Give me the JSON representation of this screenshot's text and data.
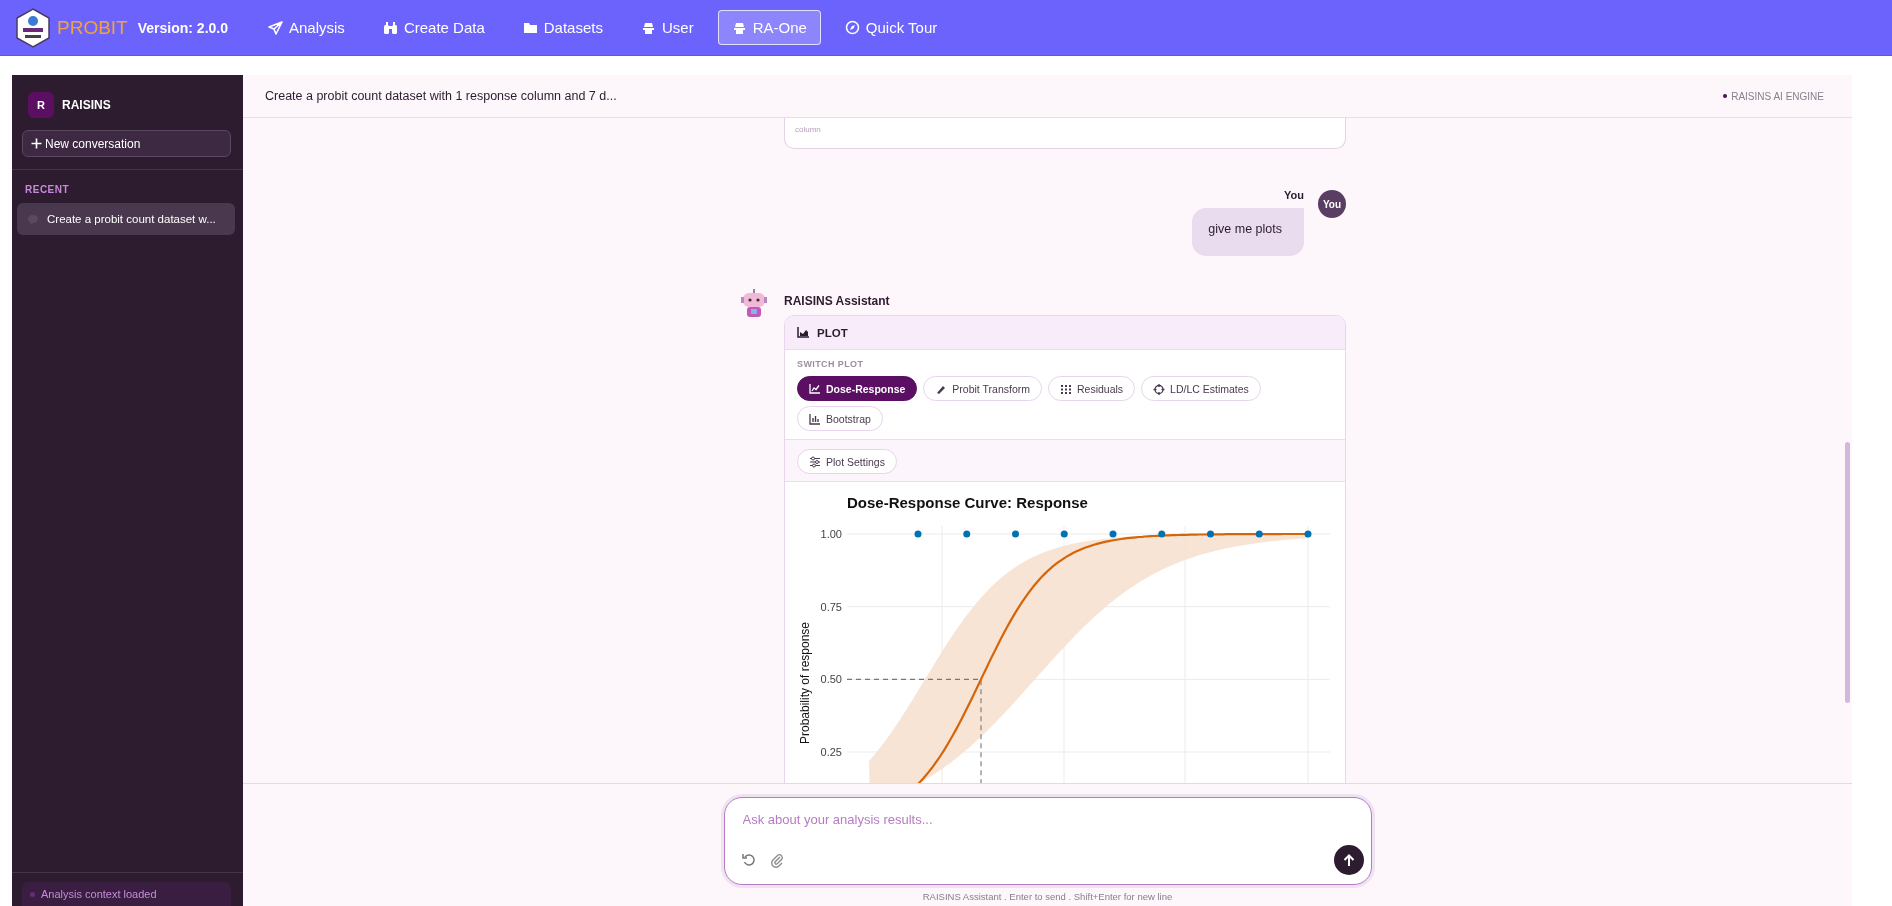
{
  "nav": {
    "brand": "PROBIT",
    "version": "Version: 2.0.0",
    "items": [
      {
        "label": "Analysis",
        "selected": false
      },
      {
        "label": "Create Data",
        "selected": false
      },
      {
        "label": "Datasets",
        "selected": false
      },
      {
        "label": "User",
        "selected": false
      },
      {
        "label": "RA-One",
        "selected": true
      },
      {
        "label": "Quick Tour",
        "selected": false
      }
    ]
  },
  "sidebar": {
    "badge": "R",
    "title": "RAISINS",
    "new_button": "New conversation",
    "section": "RECENT",
    "conversations": [
      {
        "title": "Create a probit count dataset w...",
        "selected": true
      }
    ],
    "status": "Analysis context loaded"
  },
  "header": {
    "title": "Create a probit count dataset with 1 response column and 7 d...",
    "engine": "RAISINS AI ENGINE"
  },
  "messages": [
    {
      "kind": "fragment",
      "text": "column"
    },
    {
      "kind": "user",
      "author": "You",
      "avatar": "You",
      "text": "give me plots"
    },
    {
      "kind": "assistant",
      "author": "RAISINS Assistant",
      "card": {
        "title": "PLOT",
        "switch_label": "SWITCH PLOT",
        "plots": [
          {
            "label": "Dose-Response",
            "selected": true
          },
          {
            "label": "Probit Transform",
            "selected": false
          },
          {
            "label": "Residuals",
            "selected": false
          },
          {
            "label": "LD/LC Estimates",
            "selected": false
          },
          {
            "label": "Bootstrap",
            "selected": false
          }
        ],
        "settings_button": "Plot Settings",
        "plot": {
          "title": "Dose-Response Curve: Response",
          "ylabel": "Probability of response",
          "tick_labels": [
            "1.00",
            "0.75",
            "0.50",
            "0.25"
          ]
        }
      }
    }
  ],
  "composer": {
    "placeholder": "Ask about your analysis results...",
    "hint": "RAISINS Assistant . Enter to send . Shift+Enter for new line"
  }
}
